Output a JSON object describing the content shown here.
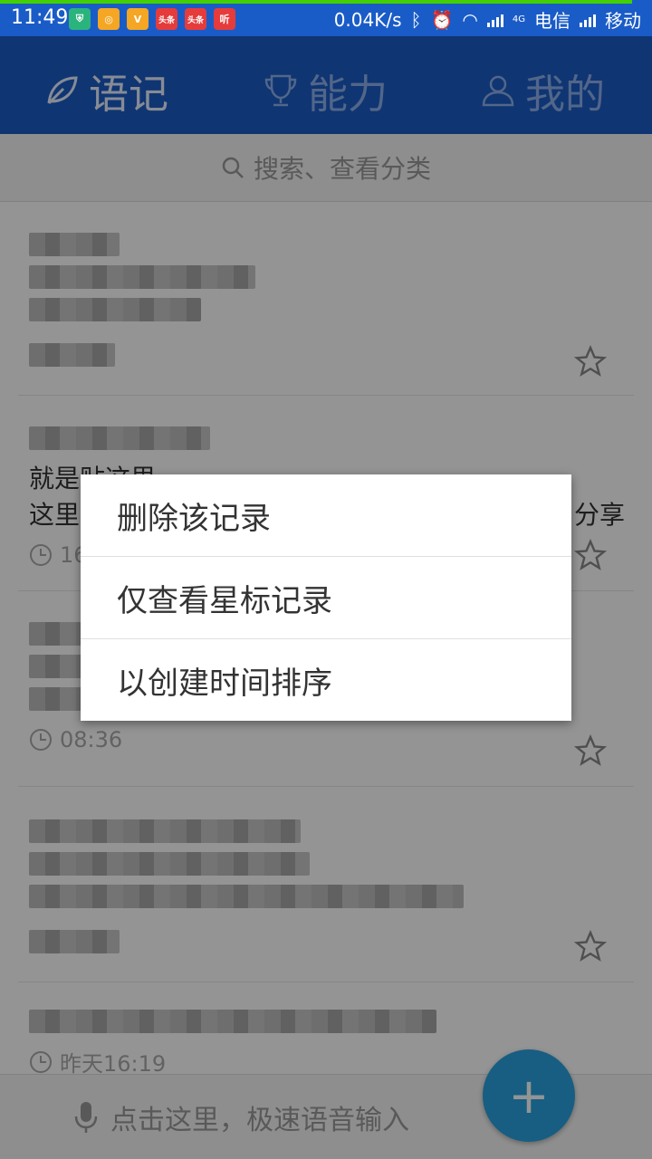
{
  "status_bar": {
    "time": "11:49",
    "apps": [
      {
        "icon": "shield-app-icon",
        "label": "",
        "color": "#2bb37d"
      },
      {
        "icon": "chat-app-icon",
        "label": "",
        "color": "#f5a623"
      },
      {
        "icon": "v-app-icon",
        "label": "V",
        "color": "#f5a623"
      },
      {
        "icon": "toutiao-app-icon",
        "label": "头条",
        "color": "#e63b3b"
      },
      {
        "icon": "toutiao-app-icon",
        "label": "头条",
        "color": "#e63b3b"
      },
      {
        "icon": "listen-app-icon",
        "label": "听",
        "color": "#e63b3b"
      }
    ],
    "speed": "0.04K/s",
    "network_label": "4G",
    "carrier1": "电信",
    "carrier2": "移动"
  },
  "header": {
    "tabs": [
      {
        "label": "语记",
        "icon": "leaf-icon",
        "active": true
      },
      {
        "label": "能力",
        "icon": "trophy-icon",
        "active": false
      },
      {
        "label": "我的",
        "icon": "person-icon",
        "active": false
      }
    ]
  },
  "search": {
    "placeholder": "搜索、查看分类"
  },
  "list": {
    "items": [
      {
        "text": "",
        "time": ""
      },
      {
        "text_line1": "就是贴这里...",
        "text_line2": "这里",
        "text_suffix": "分享",
        "time": "16"
      },
      {
        "text": "",
        "time": "08:36"
      },
      {
        "text": "",
        "time": ""
      },
      {
        "text": "",
        "time": "昨天16:19"
      }
    ]
  },
  "bottom_bar": {
    "hint": "点击这里，极速语音输入"
  },
  "fab": {
    "label": "+"
  },
  "context_menu": {
    "items": [
      {
        "label": "删除该记录"
      },
      {
        "label": "仅查看星标记录"
      },
      {
        "label": "以创建时间排序"
      }
    ]
  },
  "colors": {
    "accent": "#1a5cc7",
    "fab": "#29a3e1"
  }
}
